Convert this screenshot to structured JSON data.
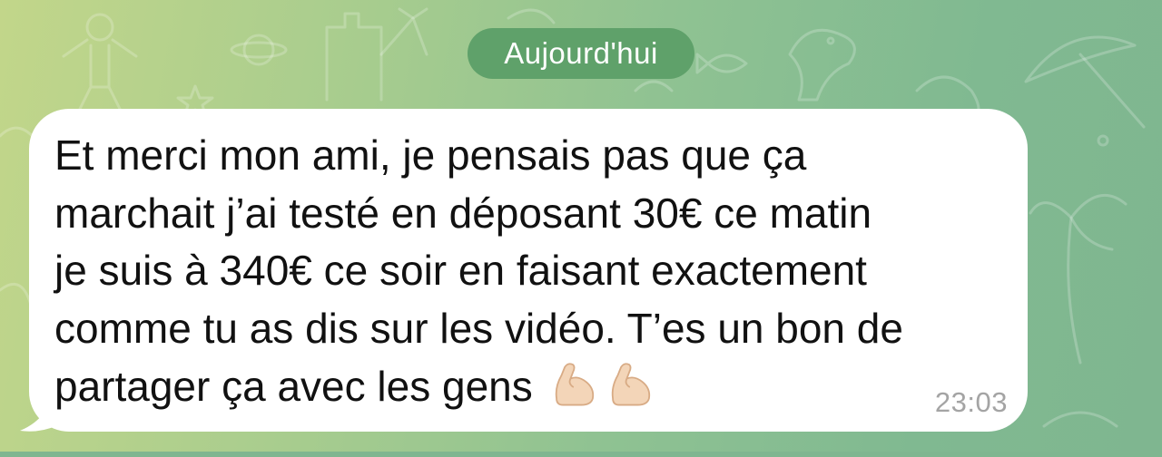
{
  "date_separator": {
    "label": "Aujourd'hui"
  },
  "message": {
    "text": "Et merci mon ami, je pensais pas que ça\nmarchait j’ai testé en déposant 30€ ce matin\nje suis à 340€ ce soir en faisant exactement\ncomme tu as dis sur les vidéo. T’es un bon de\npartager ça avec les gens",
    "emojis": [
      "flexed-biceps-icon",
      "flexed-biceps-icon"
    ],
    "time": "23:03",
    "direction": "incoming"
  },
  "colors": {
    "background_start": "#c2d68a",
    "background_end": "#7fb690",
    "date_pill": "#5fa16a",
    "bubble": "#ffffff",
    "text": "#111111",
    "timestamp": "#a4a4a4",
    "emoji_skin": "#f3d5b8"
  }
}
